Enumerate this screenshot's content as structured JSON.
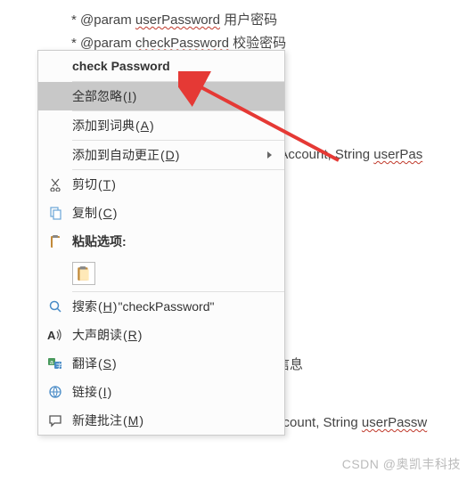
{
  "code": {
    "line1_prefix": "* @param ",
    "line1_word": "userPassword",
    "line1_suffix": "  用户密码",
    "line2_prefix": "* @param ",
    "line2_word": "checkPassword",
    "line2_suffix": "  校验密码",
    "bg1_prefix": "erAccount, String ",
    "bg1_word": "userPas",
    "bg2": "信息",
    "bg3_prefix": "Account, String ",
    "bg3_word": "userPassw"
  },
  "menu": {
    "suggestion": "check Password",
    "ignore_all": "全部忽略",
    "ignore_all_key": "I",
    "add_dict": "添加到词典",
    "add_dict_key": "A",
    "add_autocorrect": "添加到自动更正",
    "add_autocorrect_key": "D",
    "cut": "剪切",
    "cut_key": "T",
    "copy": "复制",
    "copy_key": "C",
    "paste_options": "粘贴选项:",
    "search_prefix": "搜索",
    "search_key": "H",
    "search_term": "\"checkPassword\"",
    "read_aloud": "大声朗读",
    "read_aloud_key": "R",
    "translate": "翻译",
    "translate_key": "S",
    "link": "链接",
    "link_key": "I",
    "new_comment": "新建批注",
    "new_comment_key": "M"
  },
  "watermark": "CSDN @奥凯丰科技"
}
